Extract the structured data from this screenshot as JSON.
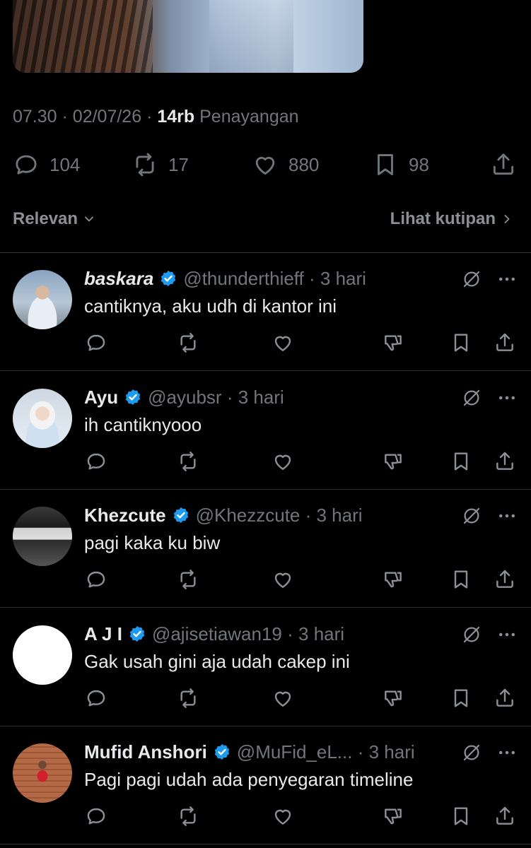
{
  "post": {
    "time": "07.30",
    "date": "02/07/26",
    "views_count": "14rb",
    "views_label": "Penayangan",
    "replies": "104",
    "reposts": "17",
    "likes": "880",
    "bookmarks": "98"
  },
  "sort": {
    "label": "Relevan",
    "quotes_link": "Lihat kutipan"
  },
  "icons": {
    "reply": "reply-icon",
    "repost": "repost-icon",
    "like": "heart-icon",
    "bookmark": "bookmark-icon",
    "share": "share-icon",
    "dislike": "dislike-icon",
    "grok": "grok-icon",
    "more": "more-icon",
    "verified": "verified-badge-icon"
  },
  "colors": {
    "verified": "#1d9bf0",
    "background": "#000000",
    "muted": "#71767b",
    "text": "#e7e9ea"
  },
  "replies": [
    {
      "name": "baskara",
      "handle": "@thunderthieff",
      "time": "3 hari",
      "text": "cantiknya, aku udh di kantor ini"
    },
    {
      "name": "Ayu",
      "handle": "@ayubsr",
      "time": "3 hari",
      "text": "ih cantiknyooo"
    },
    {
      "name": "Khezcute",
      "handle": "@Khezzcute",
      "time": "3 hari",
      "text": "pagi kaka ku biw"
    },
    {
      "name": "A J I",
      "handle": "@ajisetiawan19",
      "time": "3 hari",
      "text": "Gak usah gini aja udah cakep ini"
    },
    {
      "name": "Mufid Anshori",
      "handle": "@MuFid_eL...",
      "time": "3 hari",
      "text": "Pagi pagi udah ada penyegaran timeline"
    }
  ]
}
